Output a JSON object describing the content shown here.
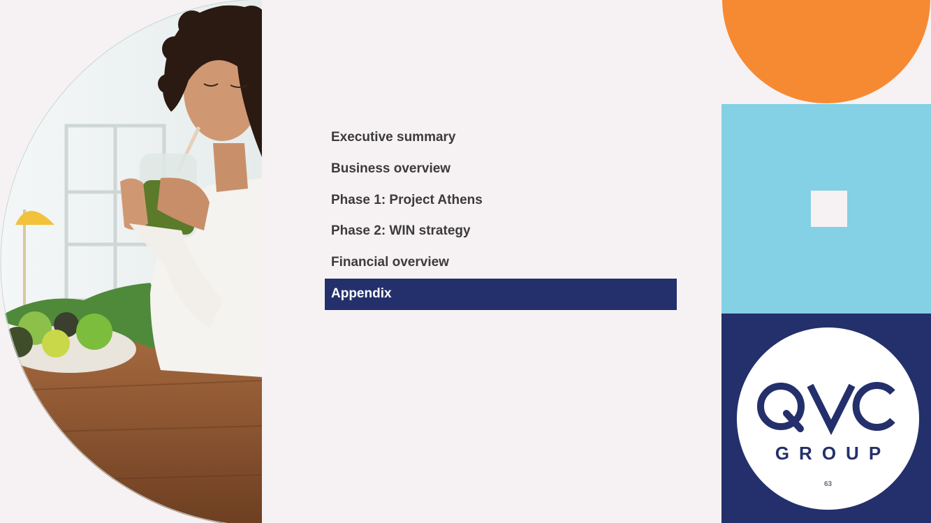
{
  "agenda": {
    "items": [
      {
        "label": "Executive summary"
      },
      {
        "label": "Business overview"
      },
      {
        "label": "Phase 1: Project Athens"
      },
      {
        "label": "Phase 2: WIN strategy"
      },
      {
        "label": "Financial overview"
      },
      {
        "label": "Appendix"
      }
    ],
    "active_index": 5
  },
  "logo": {
    "primary_text": "QVC",
    "secondary_text": "GROUP"
  },
  "page_number": "63",
  "colors": {
    "navy": "#24306b",
    "light_blue": "#84d0e5",
    "orange": "#f68a33",
    "background": "#f6f2f3"
  }
}
